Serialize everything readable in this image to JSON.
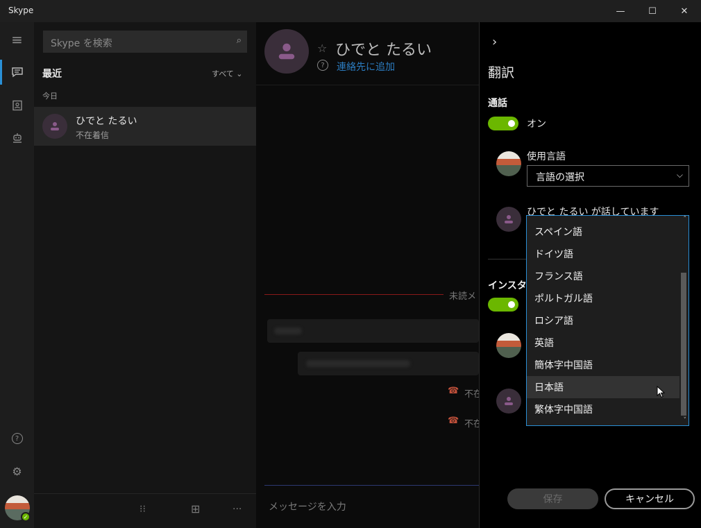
{
  "window": {
    "title": "Skype",
    "min": "—",
    "max": "☐",
    "close": "✕"
  },
  "rail": {
    "menu_icon": "≡",
    "chats_icon": "▭",
    "contacts_icon": "▤",
    "bots_icon": "⚇",
    "help_icon": "?",
    "settings_icon": "⚙",
    "presence": "✓"
  },
  "list": {
    "search_placeholder": "Skype を検索",
    "search_icon": "⌕",
    "recent_label": "最近",
    "filter_label": "すべて ⌄",
    "today_label": "今日",
    "contact": {
      "name": "ひでと たるい",
      "status": "不在着信"
    },
    "bottom_icons": {
      "dialpad": "⁝⁝",
      "new_chat": "⊞",
      "more": "···"
    }
  },
  "chat": {
    "name": "ひでと たるい",
    "star": "☆",
    "help": "?",
    "add_contact": "連絡先に追加",
    "unread_label": "未読メ",
    "missed1": "不在",
    "missed2": "不在",
    "phone_icon": "☎",
    "input_placeholder": "メッセージを入力"
  },
  "panel": {
    "back": "›",
    "title": "翻訳",
    "call_section": "通話",
    "call_toggle_label": "オン",
    "your_language_label": "使用言語",
    "language_select_value": "言語の選択",
    "chevron": "⌵",
    "speaking_label": "ひでと たるい が話しています",
    "instant_section": "インスタン",
    "save": "保存",
    "cancel": "キャンセル"
  },
  "dropdown": {
    "items": [
      "スペイン語",
      "ドイツ語",
      "フランス語",
      "ポルトガル語",
      "ロシア語",
      "英語",
      "簡体字中国語",
      "日本語",
      "繁体字中国語"
    ],
    "hovered_index": 7,
    "up": "˄",
    "down": "˅"
  },
  "colors": {
    "accent_blue": "#2a8fd6",
    "toggle_green": "#6bb700",
    "link": "#2b7cc0"
  }
}
